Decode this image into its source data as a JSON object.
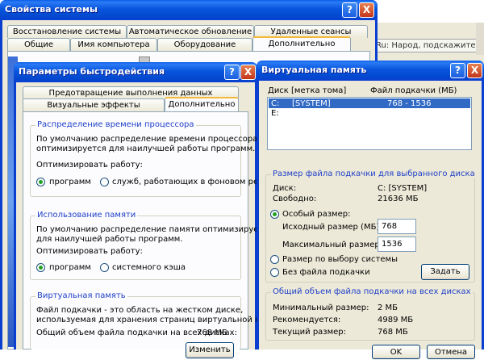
{
  "background": {
    "browser_tab_label": "Ru: Народ, подскажите ..."
  },
  "system_props": {
    "title": "Свойства системы",
    "help": "?",
    "close": "X",
    "tabs_back": [
      "Восстановление системы",
      "Автоматическое обновление",
      "Удаленные сеансы"
    ],
    "tabs_front": [
      "Общие",
      "Имя компьютера",
      "Оборудование",
      "Дополнительно"
    ]
  },
  "perf": {
    "title": "Параметры быстродействия",
    "help": "?",
    "close": "X",
    "tabs_back": [
      "Предотвращение выполнения данных"
    ],
    "tabs_front": [
      "Визуальные эффекты",
      "Дополнительно"
    ],
    "cpu": {
      "title": "Распределение времени процессора",
      "desc1": "По умолчанию распределение времени процессора",
      "desc2": "оптимизируется для наилучшей работы программ.",
      "optimize": "Оптимизировать работу:",
      "opt_programs": "программ",
      "opt_services": "служб, работающих в фоновом режиме"
    },
    "memory": {
      "title": "Использование памяти",
      "desc1": "По умолчанию распределение памяти оптимизируется",
      "desc2": "для наилучшей работы программ.",
      "optimize": "Оптимизировать работу:",
      "opt_programs": "программ",
      "opt_cache": "системного кэша"
    },
    "vm": {
      "title": "Виртуальная память",
      "desc1": "Файл подкачки - это область на жестком диске,",
      "desc2": "используемая для хранения страниц виртуальной памяти.",
      "total_label": "Общий объем файла подкачки на всех дисках:",
      "total_value": "768 МБ",
      "change_button": "Изменить"
    }
  },
  "vmem": {
    "title": "Виртуальная память",
    "help": "?",
    "close": "X",
    "col_disk": "Диск [метка тома]",
    "col_pagefile": "Файл подкачки (МБ)",
    "drives": [
      {
        "drive": "C:",
        "label": "[SYSTEM]",
        "size": "768 - 1536"
      },
      {
        "drive": "E:",
        "label": "",
        "size": ""
      }
    ],
    "selected": {
      "title": "Размер файла подкачки для выбранного диска",
      "disk_label": "Диск:",
      "disk_value": "C:  [SYSTEM]",
      "free_label": "Свободно:",
      "free_value": "21636 МБ",
      "custom_size": "Особый размер:",
      "initial_label": "Исходный размер (МБ):",
      "initial_value": "768",
      "max_label": "Максимальный размер (МБ):",
      "max_value": "1536",
      "system_managed": "Размер по выбору системы",
      "no_pagefile": "Без файла подкачки",
      "set_button": "Задать"
    },
    "total": {
      "title": "Общий объем файла подкачки на всех дисках",
      "min_label": "Минимальный размер:",
      "min_value": "2 МБ",
      "rec_label": "Рекомендуется:",
      "rec_value": "4989 МБ",
      "cur_label": "Текущий размер:",
      "cur_value": "768 МБ"
    },
    "ok_button": "OK",
    "cancel_button": "Отмена"
  }
}
